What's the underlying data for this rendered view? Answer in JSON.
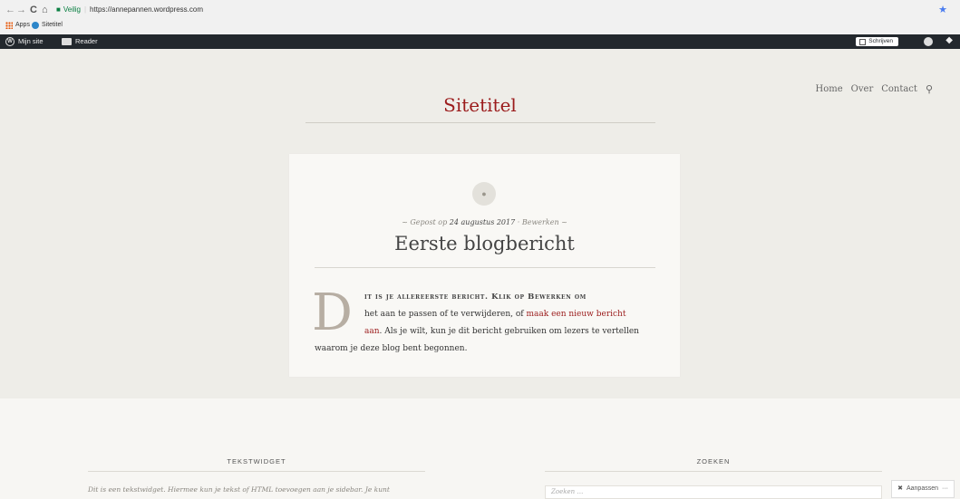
{
  "browser": {
    "nav_back": "←",
    "nav_forward": "→",
    "nav_reload": "C",
    "nav_home": "⌂",
    "secure_label": "Veilig",
    "url": "https://annepannen.wordpress.com",
    "bookmark_star": "★",
    "bookmarks": [
      "Apps",
      "Sitetitel"
    ]
  },
  "adminbar": {
    "my_site": "Mijn site",
    "reader": "Reader",
    "write": "Schrijven"
  },
  "nav": {
    "items": [
      "Home",
      "Over",
      "Contact"
    ]
  },
  "site": {
    "title": "Sitetitel"
  },
  "post": {
    "meta_prefix": "Gepost op",
    "date": "24 augustus 2017",
    "edit": "Bewerken",
    "title": "Eerste blogbericht",
    "dropcap": "D",
    "line1": "it is je allereerste bericht. Klik op Bewerken om",
    "line2": "het aan te passen of te verwijderen, of ",
    "link_a": "maak een nieuw bericht",
    "link_b": "aan",
    "line3_rest": ". Als je wilt, kun je dit bericht gebruiken om lezers te vertellen",
    "line4": "waarom je deze blog bent begonnen."
  },
  "widgets": {
    "text_title": "TEKSTWIDGET",
    "text_body": "Dit is een tekstwidget. Hiermee kun je tekst of HTML toevoegen aan je sidebar. Je kunt",
    "search_title": "ZOEKEN",
    "search_placeholder": "Zoeken …"
  },
  "customize": {
    "label": "Aanpassen",
    "more": "···"
  },
  "colors": {
    "accent": "#9b1c1c",
    "adminbar": "#23282d",
    "header_bg": "#eeede8"
  }
}
